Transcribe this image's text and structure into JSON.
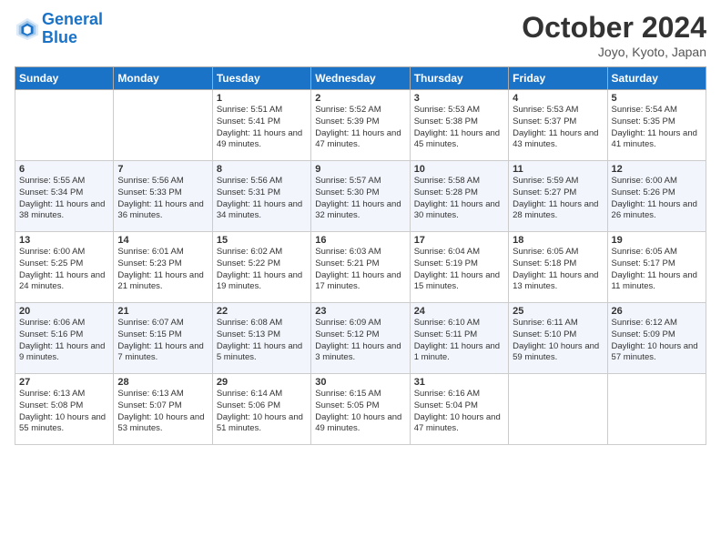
{
  "header": {
    "logo_line1": "General",
    "logo_line2": "Blue",
    "month": "October 2024",
    "location": "Joyo, Kyoto, Japan"
  },
  "days_of_week": [
    "Sunday",
    "Monday",
    "Tuesday",
    "Wednesday",
    "Thursday",
    "Friday",
    "Saturday"
  ],
  "weeks": [
    [
      {
        "day": "",
        "content": ""
      },
      {
        "day": "",
        "content": ""
      },
      {
        "day": "1",
        "content": "Sunrise: 5:51 AM\nSunset: 5:41 PM\nDaylight: 11 hours and 49 minutes."
      },
      {
        "day": "2",
        "content": "Sunrise: 5:52 AM\nSunset: 5:39 PM\nDaylight: 11 hours and 47 minutes."
      },
      {
        "day": "3",
        "content": "Sunrise: 5:53 AM\nSunset: 5:38 PM\nDaylight: 11 hours and 45 minutes."
      },
      {
        "day": "4",
        "content": "Sunrise: 5:53 AM\nSunset: 5:37 PM\nDaylight: 11 hours and 43 minutes."
      },
      {
        "day": "5",
        "content": "Sunrise: 5:54 AM\nSunset: 5:35 PM\nDaylight: 11 hours and 41 minutes."
      }
    ],
    [
      {
        "day": "6",
        "content": "Sunrise: 5:55 AM\nSunset: 5:34 PM\nDaylight: 11 hours and 38 minutes."
      },
      {
        "day": "7",
        "content": "Sunrise: 5:56 AM\nSunset: 5:33 PM\nDaylight: 11 hours and 36 minutes."
      },
      {
        "day": "8",
        "content": "Sunrise: 5:56 AM\nSunset: 5:31 PM\nDaylight: 11 hours and 34 minutes."
      },
      {
        "day": "9",
        "content": "Sunrise: 5:57 AM\nSunset: 5:30 PM\nDaylight: 11 hours and 32 minutes."
      },
      {
        "day": "10",
        "content": "Sunrise: 5:58 AM\nSunset: 5:28 PM\nDaylight: 11 hours and 30 minutes."
      },
      {
        "day": "11",
        "content": "Sunrise: 5:59 AM\nSunset: 5:27 PM\nDaylight: 11 hours and 28 minutes."
      },
      {
        "day": "12",
        "content": "Sunrise: 6:00 AM\nSunset: 5:26 PM\nDaylight: 11 hours and 26 minutes."
      }
    ],
    [
      {
        "day": "13",
        "content": "Sunrise: 6:00 AM\nSunset: 5:25 PM\nDaylight: 11 hours and 24 minutes."
      },
      {
        "day": "14",
        "content": "Sunrise: 6:01 AM\nSunset: 5:23 PM\nDaylight: 11 hours and 21 minutes."
      },
      {
        "day": "15",
        "content": "Sunrise: 6:02 AM\nSunset: 5:22 PM\nDaylight: 11 hours and 19 minutes."
      },
      {
        "day": "16",
        "content": "Sunrise: 6:03 AM\nSunset: 5:21 PM\nDaylight: 11 hours and 17 minutes."
      },
      {
        "day": "17",
        "content": "Sunrise: 6:04 AM\nSunset: 5:19 PM\nDaylight: 11 hours and 15 minutes."
      },
      {
        "day": "18",
        "content": "Sunrise: 6:05 AM\nSunset: 5:18 PM\nDaylight: 11 hours and 13 minutes."
      },
      {
        "day": "19",
        "content": "Sunrise: 6:05 AM\nSunset: 5:17 PM\nDaylight: 11 hours and 11 minutes."
      }
    ],
    [
      {
        "day": "20",
        "content": "Sunrise: 6:06 AM\nSunset: 5:16 PM\nDaylight: 11 hours and 9 minutes."
      },
      {
        "day": "21",
        "content": "Sunrise: 6:07 AM\nSunset: 5:15 PM\nDaylight: 11 hours and 7 minutes."
      },
      {
        "day": "22",
        "content": "Sunrise: 6:08 AM\nSunset: 5:13 PM\nDaylight: 11 hours and 5 minutes."
      },
      {
        "day": "23",
        "content": "Sunrise: 6:09 AM\nSunset: 5:12 PM\nDaylight: 11 hours and 3 minutes."
      },
      {
        "day": "24",
        "content": "Sunrise: 6:10 AM\nSunset: 5:11 PM\nDaylight: 11 hours and 1 minute."
      },
      {
        "day": "25",
        "content": "Sunrise: 6:11 AM\nSunset: 5:10 PM\nDaylight: 10 hours and 59 minutes."
      },
      {
        "day": "26",
        "content": "Sunrise: 6:12 AM\nSunset: 5:09 PM\nDaylight: 10 hours and 57 minutes."
      }
    ],
    [
      {
        "day": "27",
        "content": "Sunrise: 6:13 AM\nSunset: 5:08 PM\nDaylight: 10 hours and 55 minutes."
      },
      {
        "day": "28",
        "content": "Sunrise: 6:13 AM\nSunset: 5:07 PM\nDaylight: 10 hours and 53 minutes."
      },
      {
        "day": "29",
        "content": "Sunrise: 6:14 AM\nSunset: 5:06 PM\nDaylight: 10 hours and 51 minutes."
      },
      {
        "day": "30",
        "content": "Sunrise: 6:15 AM\nSunset: 5:05 PM\nDaylight: 10 hours and 49 minutes."
      },
      {
        "day": "31",
        "content": "Sunrise: 6:16 AM\nSunset: 5:04 PM\nDaylight: 10 hours and 47 minutes."
      },
      {
        "day": "",
        "content": ""
      },
      {
        "day": "",
        "content": ""
      }
    ]
  ]
}
